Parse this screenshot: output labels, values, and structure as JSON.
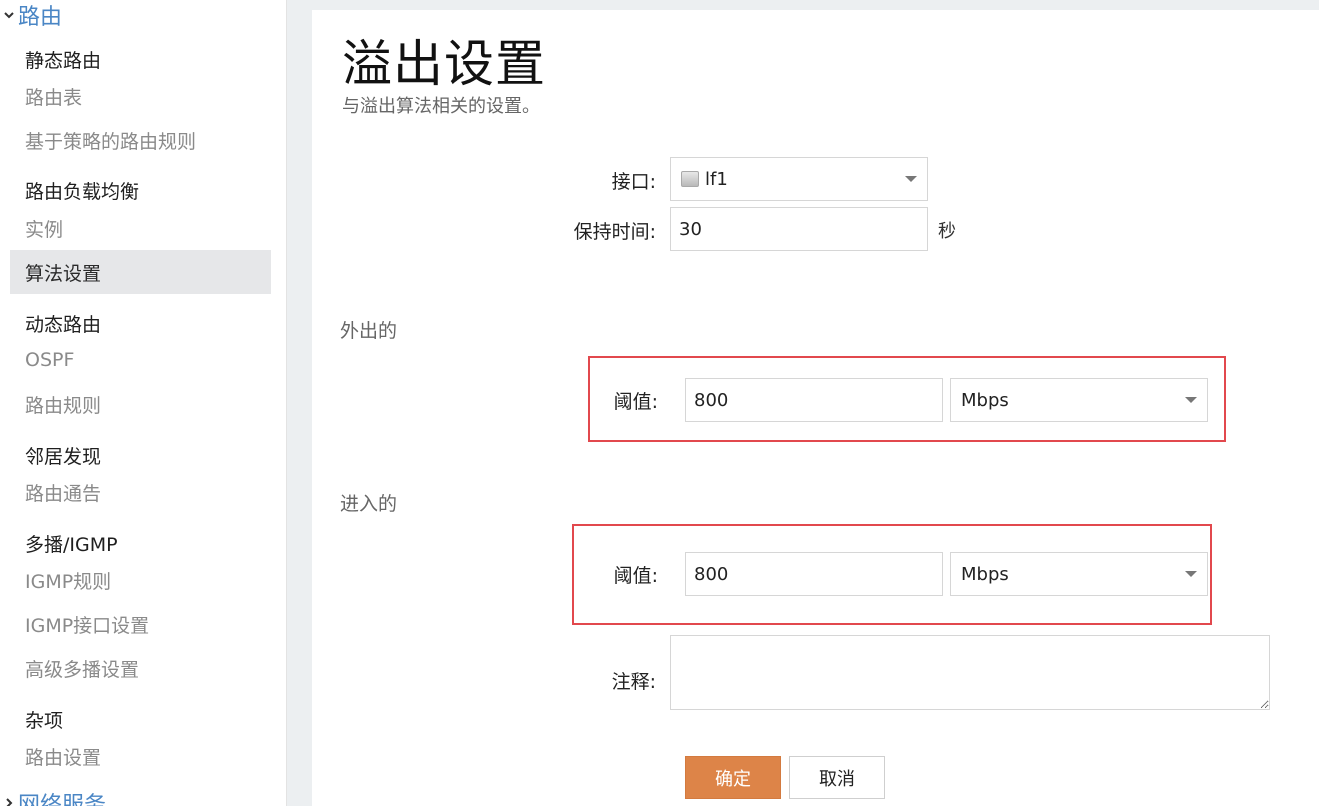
{
  "sidebar": {
    "top_section": "路由",
    "bottom_section": "网络服务",
    "groups": {
      "static": "静态路由",
      "load_balance": "路由负载均衡",
      "dynamic": "动态路由",
      "neighbor": "邻居发现",
      "multicast": "多播/IGMP",
      "misc": "杂项"
    },
    "items": {
      "route_table": "路由表",
      "pbr": "基于策略的路由规则",
      "instance": "实例",
      "algorithm": "算法设置",
      "ospf": "OSPF",
      "route_rules": "路由规则",
      "route_adv": "路由通告",
      "igmp_rules": "IGMP规则",
      "igmp_if": "IGMP接口设置",
      "adv_multicast": "高级多播设置",
      "route_settings": "路由设置"
    }
  },
  "main": {
    "title": "溢出设置",
    "subtitle": "与溢出算法相关的设置。",
    "interface_label": "接口:",
    "interface_value": "lf1",
    "hold_time_label": "保持时间:",
    "hold_time_value": "30",
    "hold_time_unit": "秒",
    "outbound": {
      "heading": "外出的",
      "threshold_label": "阈值:",
      "threshold_value": "800",
      "unit": "Mbps"
    },
    "inbound": {
      "heading": "进入的",
      "threshold_label": "阈值:",
      "threshold_value": "800",
      "unit": "Mbps"
    },
    "comment_label": "注释:",
    "comment_value": "",
    "ok_label": "确定",
    "cancel_label": "取消"
  },
  "colors": {
    "accent": "#dd8448",
    "highlight": "#e2484d",
    "section_link": "#4a86c5"
  }
}
